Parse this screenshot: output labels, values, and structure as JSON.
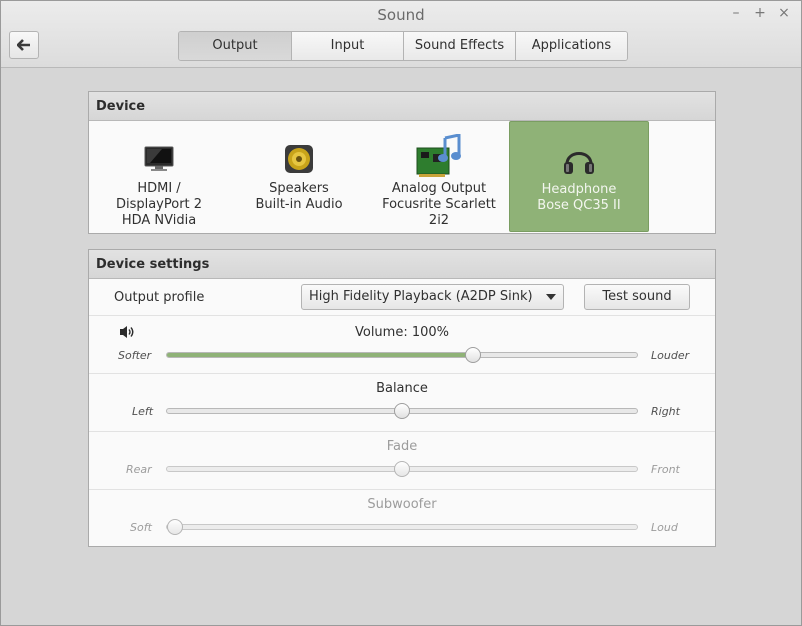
{
  "window": {
    "title": "Sound",
    "minimize_glyph": "–",
    "maximize_glyph": "+",
    "close_glyph": "×"
  },
  "tabs": [
    {
      "label": "Output",
      "active": true
    },
    {
      "label": "Input",
      "active": false
    },
    {
      "label": "Sound Effects",
      "active": false
    },
    {
      "label": "Applications",
      "active": false
    }
  ],
  "device_section": {
    "header": "Device",
    "devices": [
      {
        "line1": "HDMI /",
        "line2": "DisplayPort 2",
        "line3": "HDA NVidia",
        "icon": "monitor-icon",
        "selected": false
      },
      {
        "line1": "Speakers",
        "line2": "Built-in Audio",
        "line3": "",
        "icon": "speaker-icon",
        "selected": false
      },
      {
        "line1": "Analog Output",
        "line2": "Focusrite Scarlett",
        "line3": "2i2",
        "icon": "sound-card-icon",
        "selected": false
      },
      {
        "line1": "Headphone",
        "line2": "Bose QC35 II",
        "line3": "",
        "icon": "headphones-icon",
        "selected": true
      }
    ]
  },
  "settings": {
    "header": "Device settings",
    "output_profile_label": "Output profile",
    "output_profile_value": "High Fidelity Playback (A2DP Sink)",
    "test_sound_label": "Test sound",
    "volume": {
      "label": "Volume: 100%",
      "left": "Softer",
      "right": "Louder",
      "value_percent": 100,
      "slider_fraction": 0.65
    },
    "balance": {
      "label": "Balance",
      "left": "Left",
      "right": "Right",
      "fraction": 0.5
    },
    "fade": {
      "label": "Fade",
      "left": "Rear",
      "right": "Front",
      "fraction": 0.5,
      "disabled": true
    },
    "subwoofer": {
      "label": "Subwoofer",
      "left": "Soft",
      "right": "Loud",
      "fraction": 0.0,
      "disabled": true
    }
  },
  "colors": {
    "accent": "#8fb277"
  }
}
